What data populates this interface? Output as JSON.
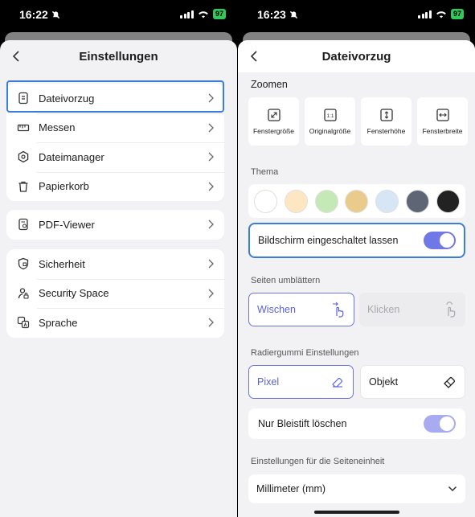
{
  "left": {
    "status": {
      "time": "16:22",
      "battery": "97"
    },
    "header": {
      "title": "Einstellungen"
    },
    "groups": [
      {
        "items": [
          {
            "label": "Dateivorzug",
            "icon": "file-preference-icon"
          },
          {
            "label": "Messen",
            "icon": "ruler-icon"
          },
          {
            "label": "Dateimanager",
            "icon": "file-manager-icon"
          },
          {
            "label": "Papierkorb",
            "icon": "trash-icon"
          }
        ]
      },
      {
        "items": [
          {
            "label": "PDF-Viewer",
            "icon": "pdf-viewer-icon"
          }
        ]
      },
      {
        "items": [
          {
            "label": "Sicherheit",
            "icon": "shield-icon"
          },
          {
            "label": "Security Space",
            "icon": "lock-person-icon"
          },
          {
            "label": "Sprache",
            "icon": "language-icon"
          }
        ]
      }
    ]
  },
  "right": {
    "status": {
      "time": "16:23",
      "battery": "97"
    },
    "header": {
      "title": "Dateivorzug"
    },
    "zoom": {
      "label": "Zoomen",
      "options": [
        "Fenstergröße",
        "Originalgröße",
        "Fensterhöhe",
        "Fensterbreite"
      ]
    },
    "theme": {
      "label": "Thema",
      "colors": [
        "#ffffff",
        "#fde7c3",
        "#c5e8b7",
        "#ebcb8c",
        "#d6e6f5",
        "#5e6675",
        "#222222"
      ]
    },
    "keep_screen_on": {
      "label": "Bildschirm eingeschaltet lassen",
      "on": true
    },
    "page_turn": {
      "label": "Seiten umblättern",
      "options": [
        {
          "label": "Wischen",
          "selected": true
        },
        {
          "label": "Klicken",
          "selected": false
        }
      ]
    },
    "eraser": {
      "label": "Radiergummi Einstellungen",
      "options": [
        {
          "label": "Pixel",
          "selected": true
        },
        {
          "label": "Objekt",
          "selected": false
        }
      ],
      "pencil_only": {
        "label": "Nur Bleistift löschen",
        "on": true
      }
    },
    "unit": {
      "label": "Einstellungen für die Seiteneinheit",
      "value": "Millimeter (mm)"
    }
  },
  "colors": {
    "accent": "#6b72e4",
    "highlight": "#3b7ddd"
  }
}
